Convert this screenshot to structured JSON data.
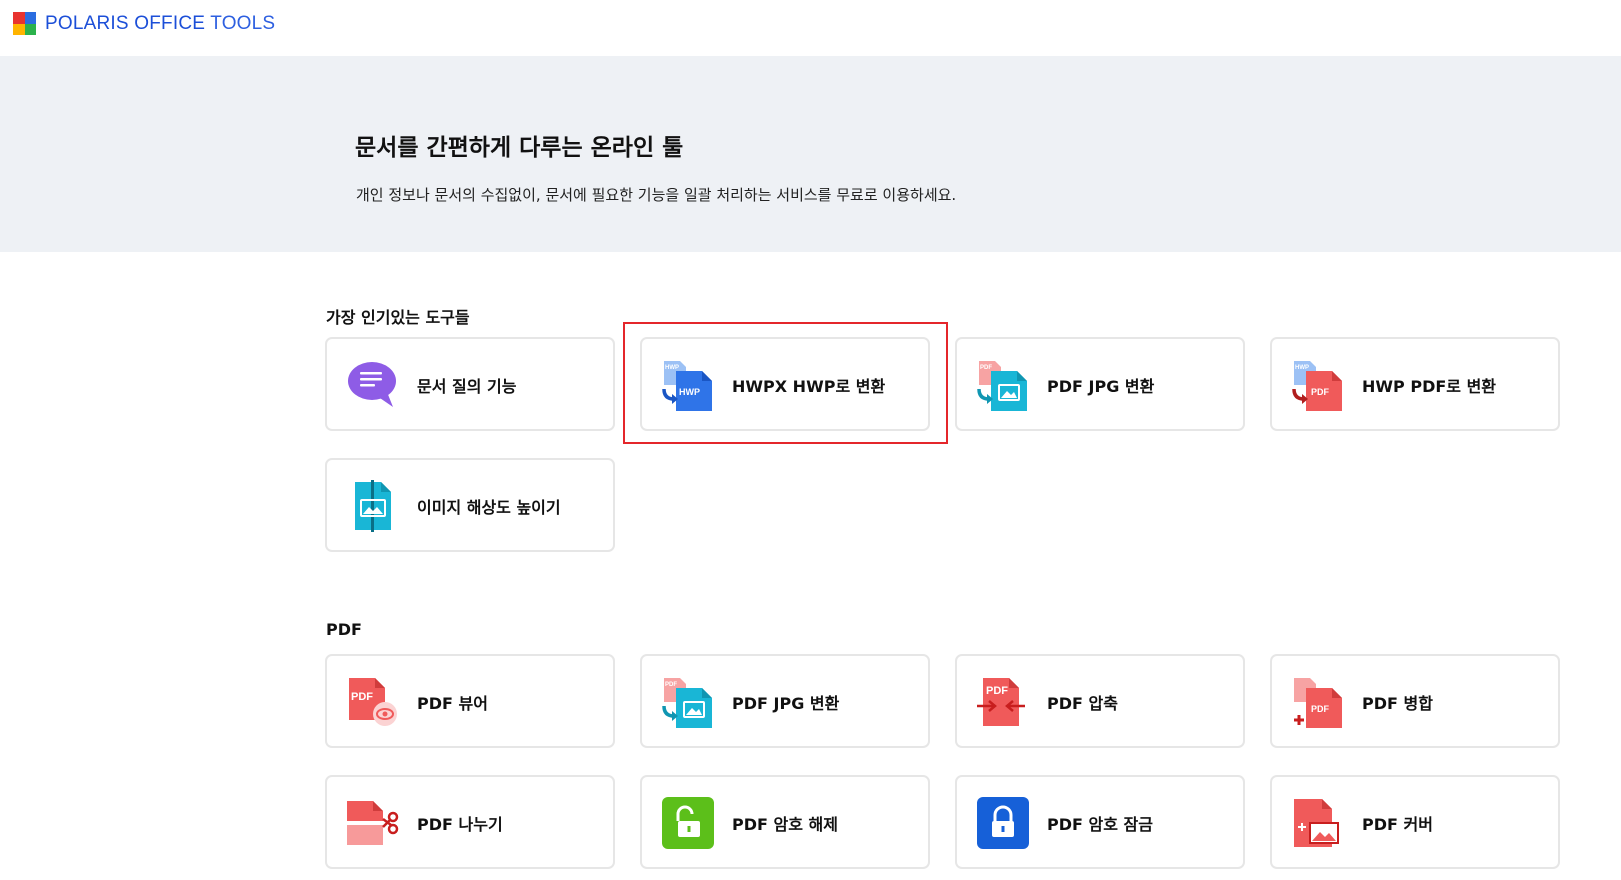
{
  "header": {
    "brand_bold": "POLARIS OFFICE",
    "brand_light": " TOOLS",
    "logo_colors": [
      "#e8332f",
      "#2b6de0",
      "#ffb400",
      "#2bb24c"
    ]
  },
  "hero": {
    "title": "문서를 간편하게 다루는 온라인 툴",
    "subtitle": "개인 정보나 문서의 수집없이, 문서에 필요한 기능을 일괄 처리하는 서비스를 무료로 이용하세요."
  },
  "sections": {
    "popular": {
      "title": "가장 인기있는 도구들",
      "items": [
        {
          "label": "문서 질의 기능",
          "icon": "chat-bubble-icon"
        },
        {
          "label": "HWPX HWP로 변환",
          "icon": "hwpx-to-hwp-icon"
        },
        {
          "label": "PDF JPG 변환",
          "icon": "pdf-to-jpg-icon"
        },
        {
          "label": "HWP PDF로 변환",
          "icon": "hwp-to-pdf-icon"
        },
        {
          "label": "이미지 해상도 높이기",
          "icon": "image-upscale-icon"
        }
      ]
    },
    "pdf": {
      "title": "PDF",
      "items": [
        {
          "label": "PDF 뷰어",
          "icon": "pdf-viewer-icon"
        },
        {
          "label": "PDF JPG 변환",
          "icon": "pdf-to-jpg-icon"
        },
        {
          "label": "PDF 압축",
          "icon": "pdf-compress-icon"
        },
        {
          "label": "PDF 병합",
          "icon": "pdf-merge-icon"
        },
        {
          "label": "PDF 나누기",
          "icon": "pdf-split-icon"
        },
        {
          "label": "PDF 암호 해제",
          "icon": "pdf-unlock-icon"
        },
        {
          "label": "PDF 암호 잠금",
          "icon": "pdf-lock-icon"
        },
        {
          "label": "PDF 커버",
          "icon": "pdf-cover-icon"
        }
      ]
    }
  },
  "icon_text": {
    "hwp": "HWP",
    "pdf": "PDF"
  },
  "colors": {
    "pdf_red": "#f05a5a",
    "teal": "#19b6d6",
    "blue": "#2f74e8",
    "purple": "#8e5ce6",
    "green": "#5cbf1a",
    "navy": "#1660d8",
    "highlight": "#e4262b"
  }
}
